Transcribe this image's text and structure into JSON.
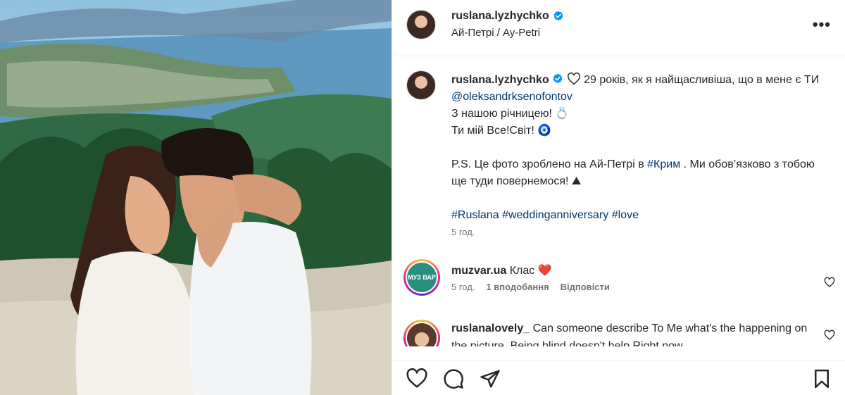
{
  "post": {
    "username": "ruslana.lyzhychko",
    "location": "Ай-Петрі / Ay-Petri",
    "more_label": "•••"
  },
  "caption": {
    "username": "ruslana.lyzhychko",
    "line1_prefix": " 29 років, як я найщасливіша, що в мене є ТИ ",
    "mention": "@oleksandrksenofontov",
    "line2": "З нашою річницею! 💍",
    "line3": "Ти мій Все!Світ! 🧿",
    "ps_prefix": "P.S. Це фото зроблено на Ай-Петрі в ",
    "ps_tag": "#Крим",
    "ps_suffix": " . Ми обов’язково з тобою ще туди повернемося! ⛰",
    "hashtags": [
      "#Ruslana",
      "#weddinganniversary",
      "#love"
    ],
    "time": "5 год."
  },
  "comments": [
    {
      "username": "muzvar.ua",
      "text": "Клас ❤️",
      "avatar_text": "МУЗ ВАР",
      "time": "5 год.",
      "likes": "1 вподобання",
      "reply": "Відповісти"
    },
    {
      "username": "ruslanalovely_",
      "text": "Can someone describe To Me what's the happening on the picture. Being blind doesn't help Right now"
    }
  ],
  "colors": {
    "verified": "#0095f6",
    "link": "#00376b",
    "secondary": "#737373",
    "text": "#262626"
  },
  "icons": [
    "verified-icon",
    "more-icon",
    "heart-icon",
    "comment-icon",
    "share-icon",
    "bookmark-icon"
  ]
}
